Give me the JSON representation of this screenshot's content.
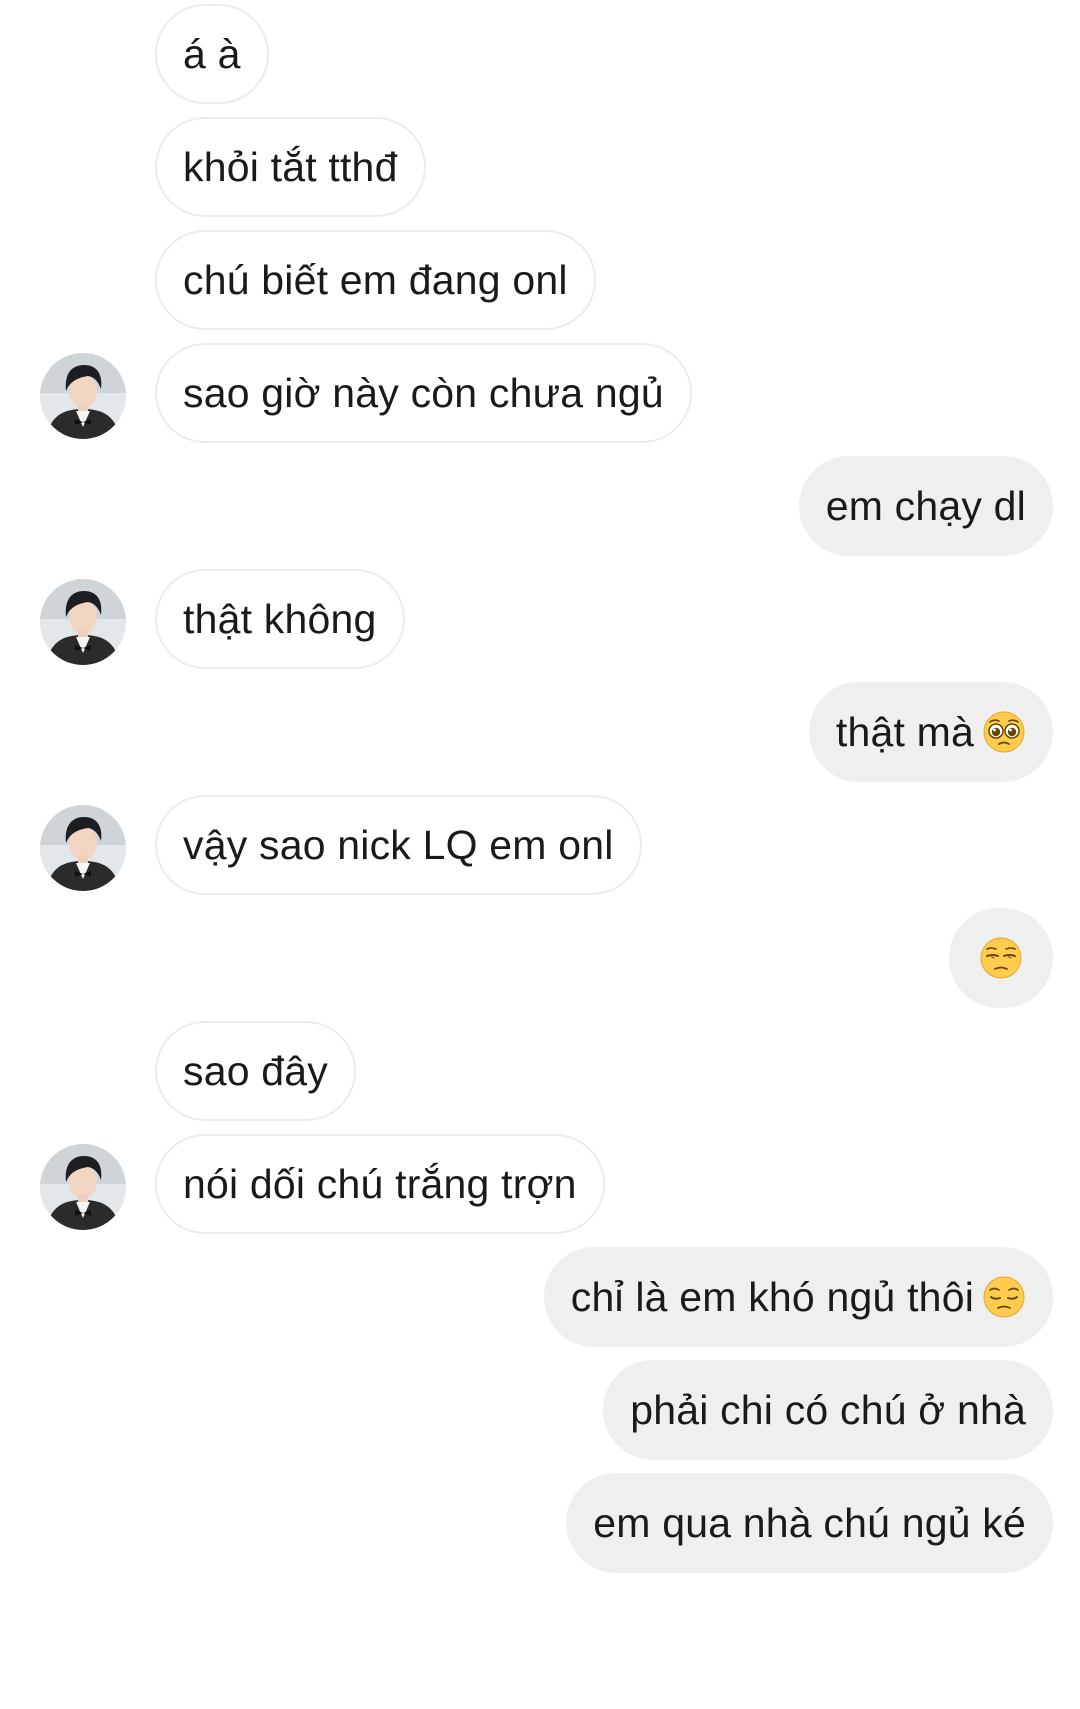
{
  "messages": [
    {
      "side": "incoming",
      "text": "á à",
      "avatar": false,
      "emoji": null
    },
    {
      "side": "incoming",
      "text": "khỏi tắt tthđ",
      "avatar": false,
      "emoji": null
    },
    {
      "side": "incoming",
      "text": "chú biết em đang onl",
      "avatar": false,
      "emoji": null
    },
    {
      "side": "incoming",
      "text": "sao giờ này còn chưa ngủ",
      "avatar": true,
      "emoji": null
    },
    {
      "side": "outgoing",
      "text": "em chạy dl",
      "avatar": false,
      "emoji": null
    },
    {
      "side": "incoming",
      "text": "thật không",
      "avatar": true,
      "emoji": null
    },
    {
      "side": "outgoing",
      "text": "thật mà",
      "avatar": false,
      "emoji": "pleading-face-emoji"
    },
    {
      "side": "incoming",
      "text": "vậy sao nick LQ em onl",
      "avatar": true,
      "emoji": null
    },
    {
      "side": "outgoing",
      "text": "",
      "avatar": false,
      "emoji": "unamused-face-emoji"
    },
    {
      "side": "incoming",
      "text": "sao đây",
      "avatar": false,
      "emoji": null
    },
    {
      "side": "incoming",
      "text": "nói dối chú trắng trợn",
      "avatar": true,
      "emoji": null
    },
    {
      "side": "outgoing",
      "text": "chỉ là em khó ngủ thôi",
      "avatar": false,
      "emoji": "pensive-face-emoji"
    },
    {
      "side": "outgoing",
      "text": "phải chi có chú ở nhà",
      "avatar": false,
      "emoji": null
    },
    {
      "side": "outgoing",
      "text": "em qua nhà chú ngủ ké",
      "avatar": false,
      "emoji": null
    }
  ],
  "colors": {
    "incoming_bubble": "#ffffff",
    "incoming_border": "#ececec",
    "outgoing_bubble": "#efefef",
    "text": "#1a1a1a",
    "emoji_yellow": "#ffcc4d"
  }
}
